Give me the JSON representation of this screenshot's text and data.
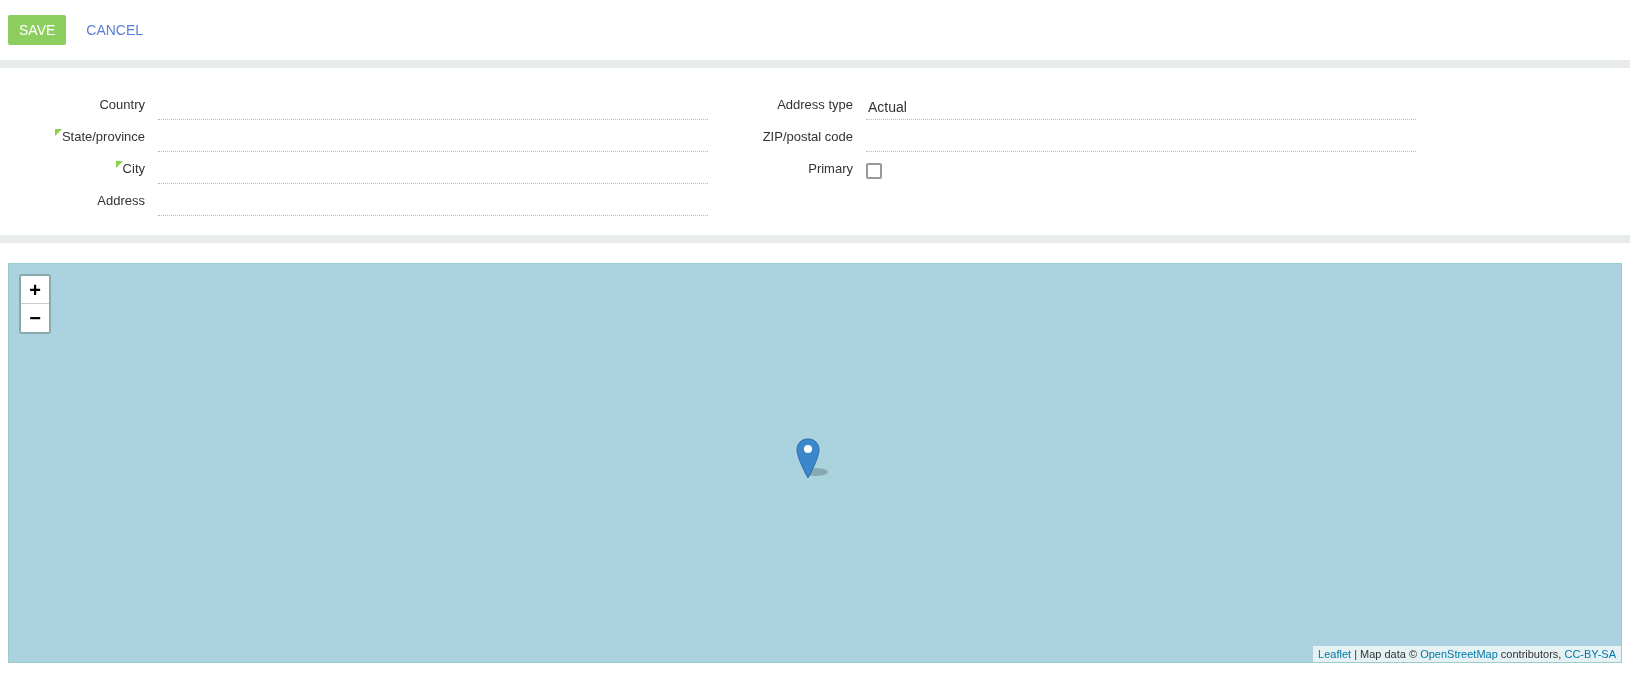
{
  "toolbar": {
    "save": "SAVE",
    "cancel": "CANCEL"
  },
  "form": {
    "left": [
      {
        "kind": "text",
        "label": "Country"
      },
      {
        "kind": "text",
        "label": "State/province",
        "required": true
      },
      {
        "kind": "text",
        "label": "City",
        "required": true
      },
      {
        "kind": "text",
        "label": "Address"
      }
    ],
    "right": [
      {
        "kind": "text",
        "label": "Address type",
        "value": "Actual"
      },
      {
        "kind": "text",
        "label": "ZIP/postal code"
      },
      {
        "kind": "checkbox",
        "label": "Primary",
        "checked": false
      }
    ]
  },
  "map": {
    "zoom_in": "+",
    "zoom_out": "−",
    "attribution": [
      {
        "kind": "link",
        "text": "Leaflet"
      },
      {
        "kind": "text",
        "text": " | Map data © "
      },
      {
        "kind": "link",
        "text": "OpenStreetMap"
      },
      {
        "kind": "text",
        "text": " contributors, "
      },
      {
        "kind": "link",
        "text": "CC-BY-SA"
      }
    ]
  }
}
